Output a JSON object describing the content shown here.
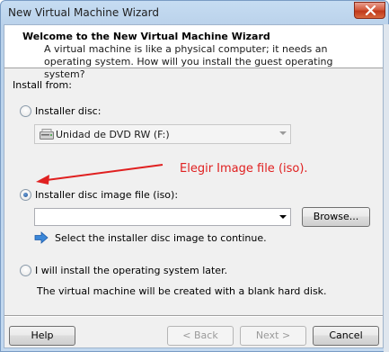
{
  "window": {
    "title": "New Virtual Machine Wizard"
  },
  "header": {
    "title": "Welcome to the New Virtual Machine Wizard",
    "description": "A virtual machine is like a physical computer; it needs an operating system. How will you install the guest operating system?"
  },
  "install_from": {
    "label": "Install from:",
    "selected": "iso",
    "installer_disc": {
      "label": "Installer disc:",
      "drive": "Unidad de DVD RW (F:)"
    },
    "iso": {
      "label": "Installer disc image file (iso):",
      "path_value": "",
      "browse_label": "Browse...",
      "hint": "Select the installer disc image to continue."
    },
    "later": {
      "label": "I will install the operating system later.",
      "note": "The virtual machine will be created with a blank hard disk."
    }
  },
  "annotation": {
    "text": "Elegir Image file (iso).",
    "color": "#e02020"
  },
  "footer": {
    "help_label": "Help",
    "back_label": "< Back",
    "next_label": "Next >",
    "cancel_label": "Cancel"
  }
}
